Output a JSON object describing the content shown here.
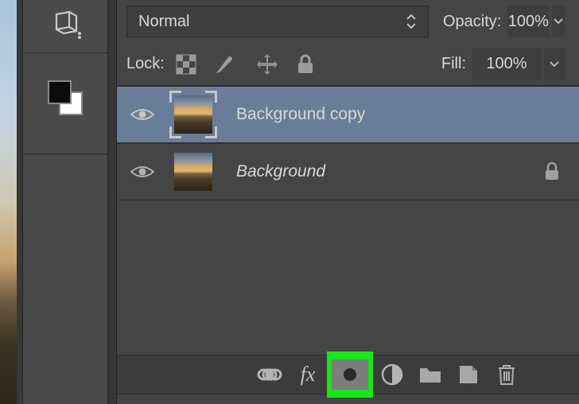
{
  "blend": {
    "mode": "Normal",
    "opacity_label": "Opacity:",
    "opacity_value": "100%"
  },
  "lock": {
    "label": "Lock:",
    "fill_label": "Fill:",
    "fill_value": "100%"
  },
  "layers": [
    {
      "name": "Background copy",
      "locked": false,
      "selected": true
    },
    {
      "name": "Background",
      "locked": true,
      "selected": false,
      "italic": true
    }
  ],
  "bottombar": {
    "icons": [
      "link",
      "fx",
      "mask",
      "adjustment",
      "group",
      "new-layer",
      "trash"
    ]
  }
}
